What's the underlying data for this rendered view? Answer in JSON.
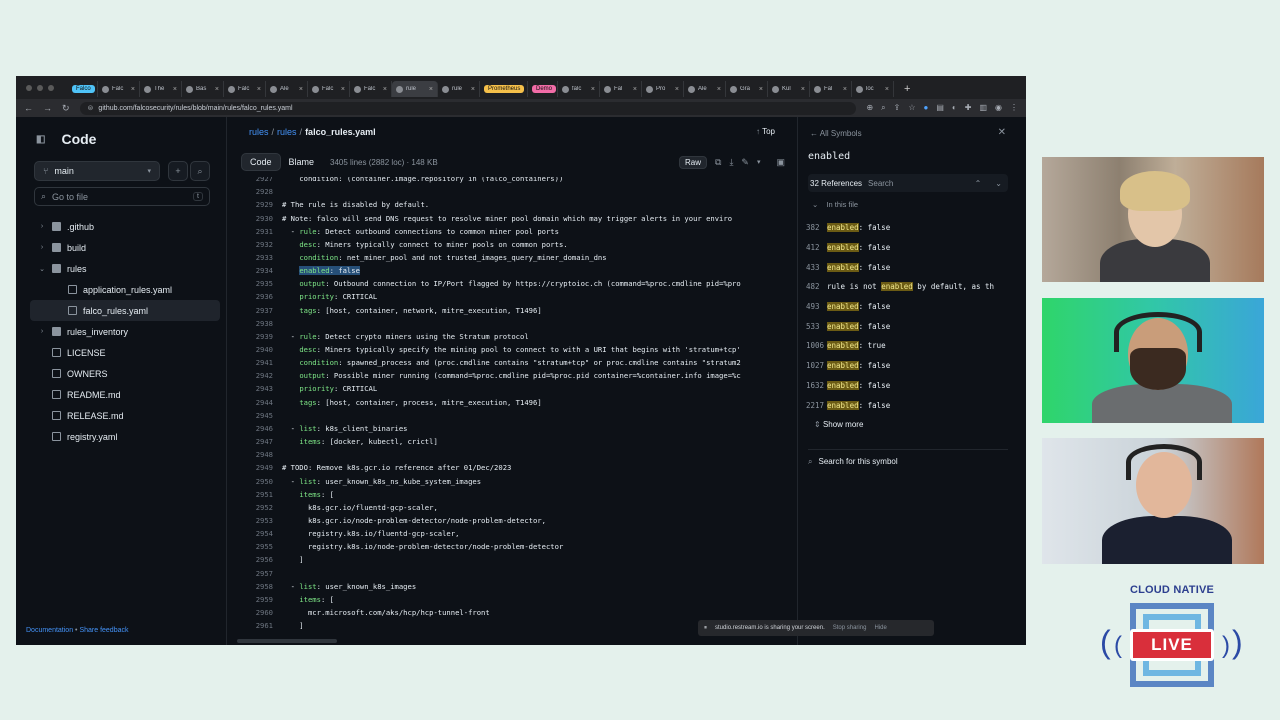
{
  "browser": {
    "tabs": [
      {
        "label": "Falco",
        "badge": true,
        "badge_color": "#4fc3f7"
      },
      {
        "label": "Falc"
      },
      {
        "label": "The"
      },
      {
        "label": "Bas"
      },
      {
        "label": "Falc"
      },
      {
        "label": "Ale"
      },
      {
        "label": "Falc"
      },
      {
        "label": "Falc"
      },
      {
        "label": "rule",
        "active": true
      },
      {
        "label": "rule"
      },
      {
        "label": "Prometheus",
        "badge": true,
        "badge_color": "#f5c04a"
      },
      {
        "label": "Demo",
        "badge": true,
        "badge_color": "#f26ca7"
      },
      {
        "label": "falc"
      },
      {
        "label": "Fal"
      },
      {
        "label": "Pro"
      },
      {
        "label": "Ale"
      },
      {
        "label": "Gra"
      },
      {
        "label": "Kul"
      },
      {
        "label": "Fal"
      },
      {
        "label": "loc"
      }
    ],
    "new_tab": "+",
    "url": "github.com/falcosecurity/rules/blob/main/rules/falco_rules.yaml"
  },
  "sidebar": {
    "title": "Code",
    "branch": "main",
    "goto_placeholder": "Go to file",
    "goto_key": "t",
    "tree": [
      {
        "label": ".github",
        "type": "folder",
        "indent": 0,
        "chevron": "›"
      },
      {
        "label": "build",
        "type": "folder",
        "indent": 0,
        "chevron": "›"
      },
      {
        "label": "rules",
        "type": "folder",
        "indent": 0,
        "chevron": "⌄"
      },
      {
        "label": "application_rules.yaml",
        "type": "file",
        "indent": 1
      },
      {
        "label": "falco_rules.yaml",
        "type": "file",
        "indent": 1,
        "selected": true
      },
      {
        "label": "rules_inventory",
        "type": "folder",
        "indent": 0,
        "chevron": "›"
      },
      {
        "label": "LICENSE",
        "type": "file",
        "indent": 0
      },
      {
        "label": "OWNERS",
        "type": "file",
        "indent": 0
      },
      {
        "label": "README.md",
        "type": "file",
        "indent": 0
      },
      {
        "label": "RELEASE.md",
        "type": "file",
        "indent": 0
      },
      {
        "label": "registry.yaml",
        "type": "file",
        "indent": 0
      }
    ],
    "footer_docs": "Documentation",
    "footer_sep": "•",
    "footer_feedback": "Share feedback"
  },
  "main": {
    "crumb_repo": "rules",
    "crumb_dir": "rules",
    "crumb_file": "falco_rules.yaml",
    "top": "Top",
    "tab_code": "Code",
    "tab_blame": "Blame",
    "file_meta": "3405 lines (2882 loc) · 148 KB",
    "raw": "Raw"
  },
  "code_lines": [
    {
      "n": "2927",
      "t": "    condition: (container.image.repository in (falco_containers))"
    },
    {
      "n": "2928",
      "t": ""
    },
    {
      "n": "2929",
      "t": "# The rule is disabled by default.",
      "c": true
    },
    {
      "n": "2930",
      "t": "# Note: falco will send DNS request to resolve miner pool domain which may trigger alerts in your enviro",
      "c": true
    },
    {
      "n": "2931",
      "t": "  - rule: Detect outbound connections to common miner pool ports",
      "k": "rule"
    },
    {
      "n": "2932",
      "t": "    desc: Miners typically connect to miner pools on common ports.",
      "k": "desc"
    },
    {
      "n": "2933",
      "t": "    condition: net_miner_pool and not trusted_images_query_miner_domain_dns",
      "k": "condition"
    },
    {
      "n": "2934",
      "t": "    enabled: false",
      "k": "enabled",
      "hl": true
    },
    {
      "n": "2935",
      "t": "    output: Outbound connection to IP/Port flagged by https://cryptoioc.ch (command=%proc.cmdline pid=%pro",
      "k": "output"
    },
    {
      "n": "2936",
      "t": "    priority: CRITICAL",
      "k": "priority"
    },
    {
      "n": "2937",
      "t": "    tags: [host, container, network, mitre_execution, T1496]",
      "k": "tags"
    },
    {
      "n": "2938",
      "t": ""
    },
    {
      "n": "2939",
      "t": "  - rule: Detect crypto miners using the Stratum protocol",
      "k": "rule"
    },
    {
      "n": "2940",
      "t": "    desc: Miners typically specify the mining pool to connect to with a URI that begins with 'stratum+tcp'",
      "k": "desc"
    },
    {
      "n": "2941",
      "t": "    condition: spawned_process and (proc.cmdline contains \"stratum+tcp\" or proc.cmdline contains \"stratum2",
      "k": "condition"
    },
    {
      "n": "2942",
      "t": "    output: Possible miner running (command=%proc.cmdline pid=%proc.pid container=%container.info image=%c",
      "k": "output"
    },
    {
      "n": "2943",
      "t": "    priority: CRITICAL",
      "k": "priority"
    },
    {
      "n": "2944",
      "t": "    tags: [host, container, process, mitre_execution, T1496]",
      "k": "tags"
    },
    {
      "n": "2945",
      "t": ""
    },
    {
      "n": "2946",
      "t": "  - list: k8s_client_binaries",
      "k": "list"
    },
    {
      "n": "2947",
      "t": "    items: [docker, kubectl, crictl]",
      "k": "items"
    },
    {
      "n": "2948",
      "t": ""
    },
    {
      "n": "2949",
      "t": "# TODO: Remove k8s.gcr.io reference after 01/Dec/2023",
      "c": true
    },
    {
      "n": "2950",
      "t": "  - list: user_known_k8s_ns_kube_system_images",
      "k": "list"
    },
    {
      "n": "2951",
      "t": "    items: [",
      "k": "items"
    },
    {
      "n": "2952",
      "t": "      k8s.gcr.io/fluentd-gcp-scaler,"
    },
    {
      "n": "2953",
      "t": "      k8s.gcr.io/node-problem-detector/node-problem-detector,"
    },
    {
      "n": "2954",
      "t": "      registry.k8s.io/fluentd-gcp-scaler,"
    },
    {
      "n": "2955",
      "t": "      registry.k8s.io/node-problem-detector/node-problem-detector"
    },
    {
      "n": "2956",
      "t": "    ]"
    },
    {
      "n": "2957",
      "t": ""
    },
    {
      "n": "2958",
      "t": "  - list: user_known_k8s_images",
      "k": "list"
    },
    {
      "n": "2959",
      "t": "    items: [",
      "k": "items"
    },
    {
      "n": "2960",
      "t": "      mcr.microsoft.com/aks/hcp/hcp-tunnel-front"
    },
    {
      "n": "2961",
      "t": "    ]"
    }
  ],
  "symbols": {
    "header": "All Symbols",
    "symbol": "enabled",
    "refs_count": "32 References",
    "refs_search": "Search",
    "in_file": "In this file",
    "refs": [
      {
        "line": "382",
        "pre": "",
        "word": "enabled",
        "post": ": false"
      },
      {
        "line": "412",
        "pre": "",
        "word": "enabled",
        "post": ": false"
      },
      {
        "line": "433",
        "pre": "",
        "word": "enabled",
        "post": ": false"
      },
      {
        "line": "482",
        "pre": "rule is not ",
        "word": "enabled",
        "post": " by default, as th"
      },
      {
        "line": "493",
        "pre": "",
        "word": "enabled",
        "post": ": false"
      },
      {
        "line": "533",
        "pre": "",
        "word": "enabled",
        "post": ": false"
      },
      {
        "line": "1006",
        "pre": "",
        "word": "enabled",
        "post": ": true"
      },
      {
        "line": "1027",
        "pre": "",
        "word": "enabled",
        "post": ": false"
      },
      {
        "line": "1632",
        "pre": "",
        "word": "enabled",
        "post": ": false"
      },
      {
        "line": "2217",
        "pre": "",
        "word": "enabled",
        "post": ": false"
      }
    ],
    "show_more": "Show more",
    "search_symbol": "Search for this symbol"
  },
  "share_bar": {
    "text": "studio.restream.io is sharing your screen.",
    "stop": "Stop sharing",
    "hide": "Hide"
  },
  "logo": {
    "title": "CLOUD NATIVE",
    "badge": "LIVE"
  },
  "colors": {
    "page_bg": "#e4f1ec",
    "github_bg": "#0d1117",
    "link": "#4493f8",
    "yaml_key": "#7ee787",
    "live_red": "#d92f3b"
  }
}
